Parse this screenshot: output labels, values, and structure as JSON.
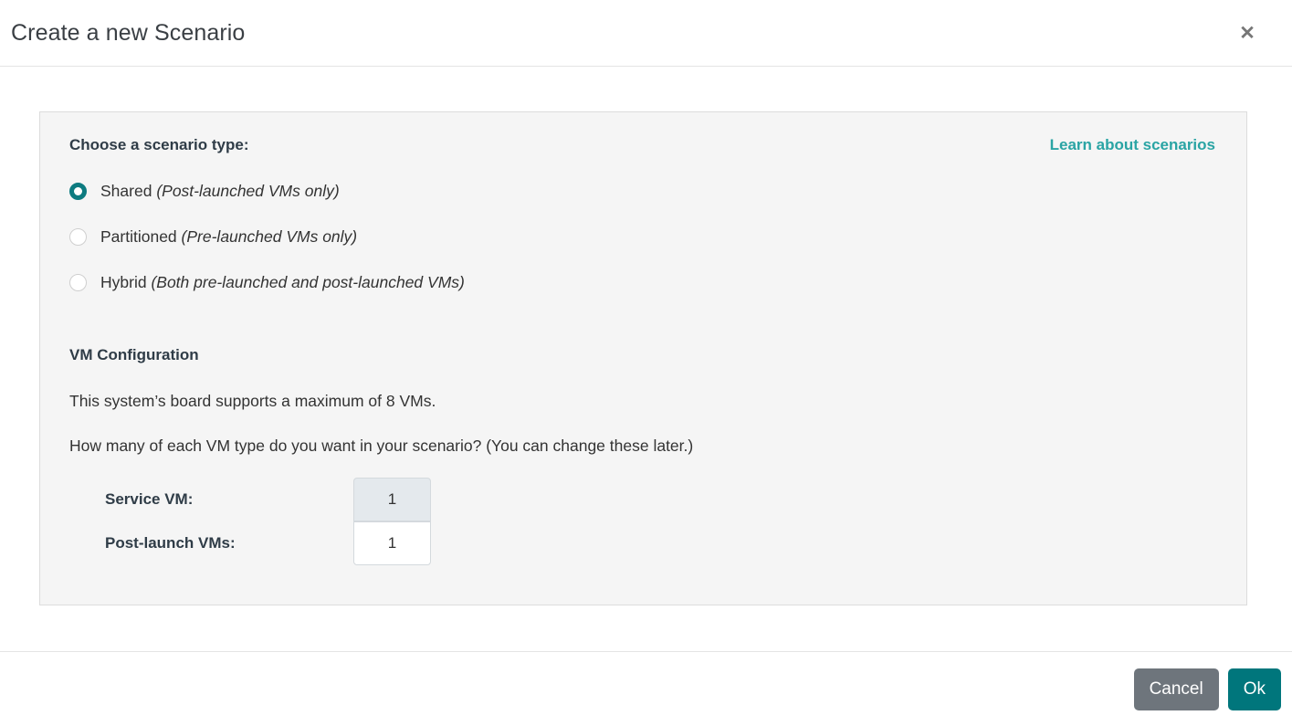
{
  "dialog": {
    "title": "Create a new Scenario",
    "close_icon": "close-icon",
    "close_glyph": "✕"
  },
  "scenario_type": {
    "label": "Choose a scenario type:",
    "learn_link": "Learn about scenarios",
    "selected": "Shared",
    "options": [
      {
        "name": "Shared",
        "hint": "(Post-launched VMs only)",
        "checked": true
      },
      {
        "name": "Partitioned",
        "hint": "(Pre-launched VMs only)",
        "checked": false
      },
      {
        "name": "Hybrid",
        "hint": "(Both pre-launched and post-launched VMs)",
        "checked": false
      }
    ]
  },
  "vm_configuration": {
    "title": "VM Configuration",
    "max_note": "This system’s board supports a maximum of 8 VMs.",
    "question": "How many of each VM type do you want in your scenario? (You can change these later.)",
    "max_vms": "8",
    "fields": [
      {
        "label": "Service VM:",
        "value": "1",
        "disabled": true
      },
      {
        "label": "Post-launch VMs:",
        "value": "1",
        "disabled": false
      }
    ]
  },
  "footer": {
    "cancel_label": "Cancel",
    "ok_label": "Ok"
  },
  "colors": {
    "accent_teal": "#00767c",
    "link_teal": "#2aa4a4",
    "cancel_gray": "#6e757c",
    "panel_bg": "#f5f5f5",
    "disabled_input_bg": "#e4e9ed",
    "heading_text": "#2f3c47"
  }
}
